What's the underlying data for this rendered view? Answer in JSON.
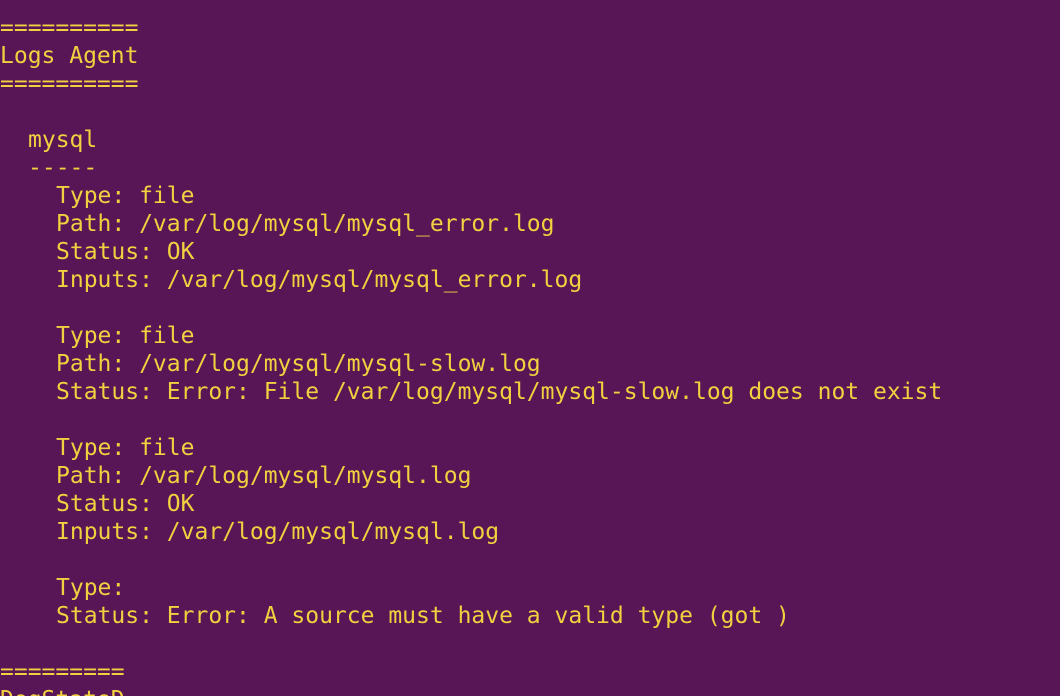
{
  "terminal": {
    "background_color": "#581656",
    "text_color": "#f0d13f",
    "section_rule": "==========",
    "section_title": "Logs Agent",
    "integration": {
      "name": "mysql",
      "underline": "-----"
    },
    "sources": [
      {
        "type": "Type: file",
        "path": "Path: /var/log/mysql/mysql_error.log",
        "status": "Status: OK",
        "inputs": "Inputs: /var/log/mysql/mysql_error.log"
      },
      {
        "type": "Type: file",
        "path": "Path: /var/log/mysql/mysql-slow.log",
        "status": "Status: Error: File /var/log/mysql/mysql-slow.log does not exist"
      },
      {
        "type": "Type: file",
        "path": "Path: /var/log/mysql/mysql.log",
        "status": "Status: OK",
        "inputs": "Inputs: /var/log/mysql/mysql.log"
      },
      {
        "type": "Type:",
        "status": "Status: Error: A source must have a valid type (got )"
      }
    ],
    "next_section_rule": "=========",
    "next_section_title": "DogStatsD"
  }
}
